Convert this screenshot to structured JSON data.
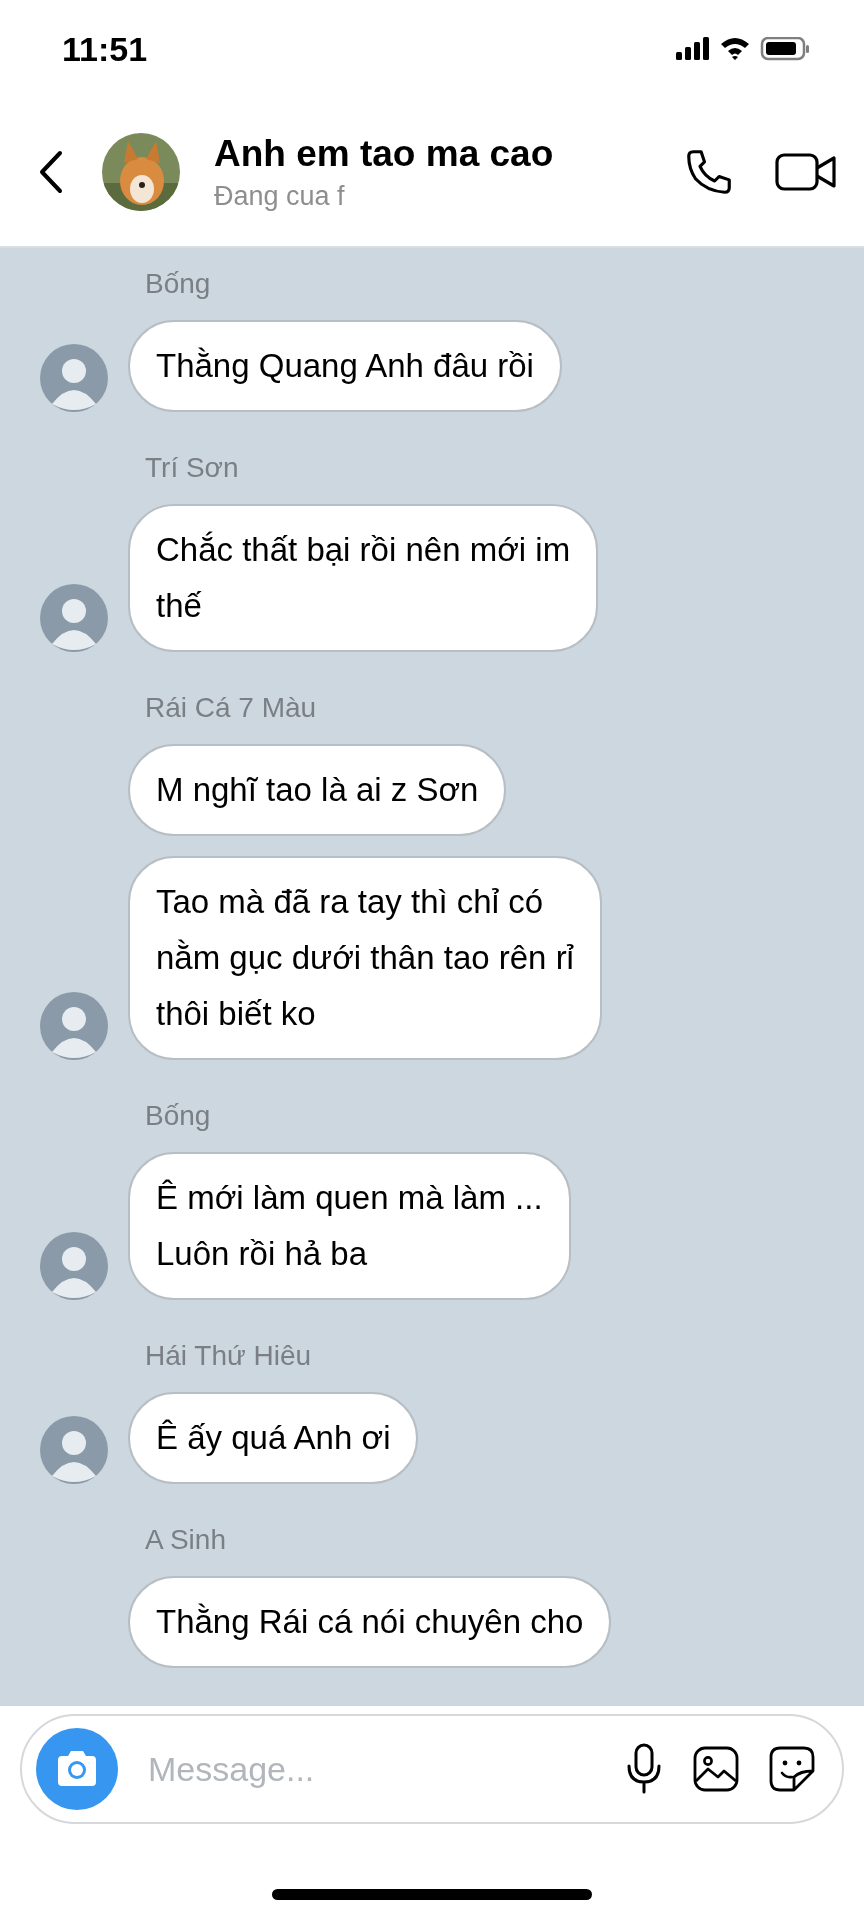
{
  "status_bar": {
    "time": "11:51"
  },
  "header": {
    "title": "Anh em tao ma cao",
    "subtitle": "Đang cua f"
  },
  "groups": [
    {
      "sender": "Bống",
      "avatar": true,
      "messages": [
        "Thằng Quang Anh đâu rồi"
      ]
    },
    {
      "sender": "Trí Sơn",
      "avatar": true,
      "messages": [
        "Chắc thất bại rồi nên mới im\nthế"
      ]
    },
    {
      "sender": "Rái Cá 7 Màu",
      "avatar": true,
      "messages": [
        "M nghĩ tao là ai z Sơn",
        "Tao mà đã ra tay thì chỉ có\nnằm gục dưới thân tao rên rỉ\nthôi biết ko"
      ]
    },
    {
      "sender": "Bống",
      "avatar": true,
      "messages": [
        "Ê mới làm quen mà làm ...\nLuôn rồi hả ba"
      ]
    },
    {
      "sender": "Hái Thứ Hiêu",
      "avatar": true,
      "messages": [
        "Ê ấy quá Anh ơi"
      ]
    },
    {
      "sender": "A Sinh",
      "avatar": false,
      "messages": [
        "Thằng Rái cá nói chuyên cho"
      ]
    }
  ],
  "composer": {
    "placeholder": "Message..."
  }
}
